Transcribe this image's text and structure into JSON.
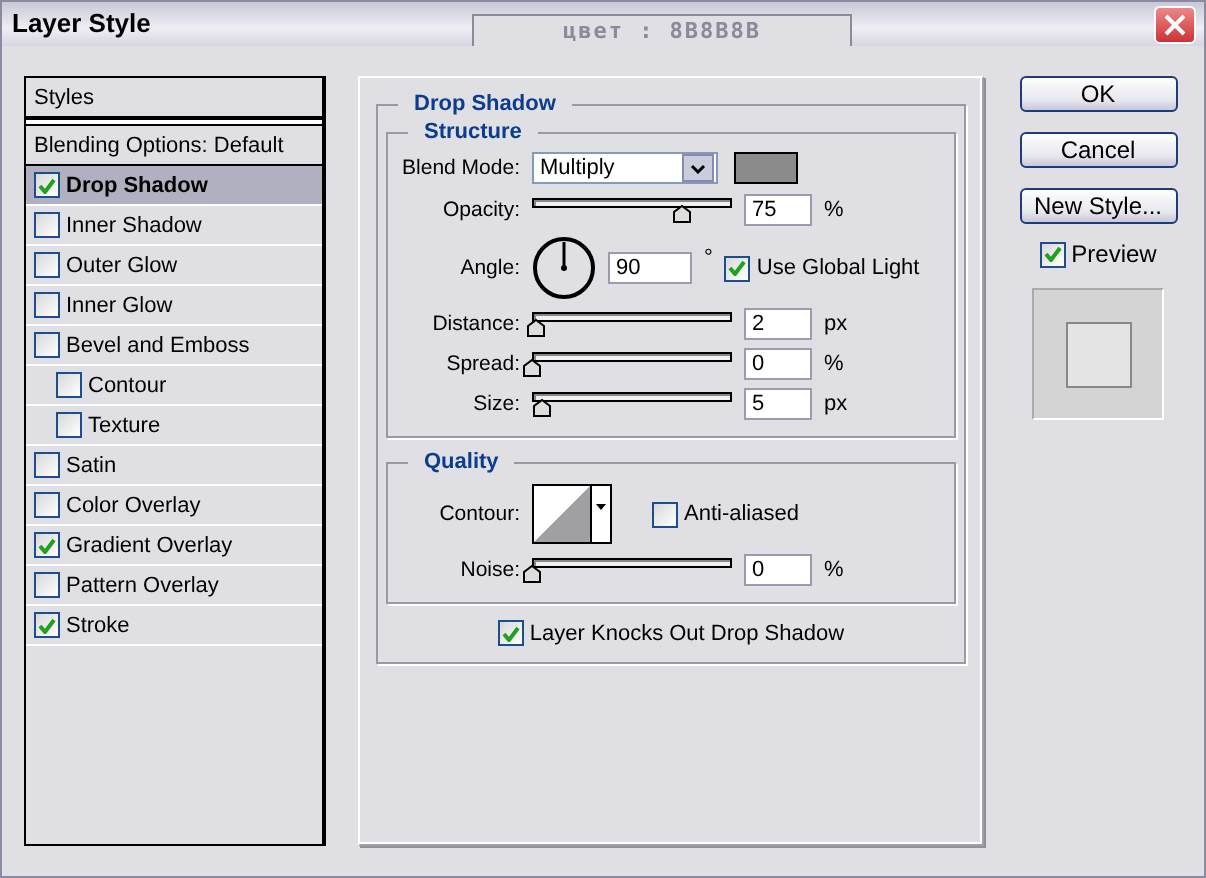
{
  "window": {
    "title": "Layer Style",
    "tab": "цвет : 8B8B8B"
  },
  "sidebar": {
    "items": [
      {
        "label": "Styles",
        "kind": "header"
      },
      {
        "label": "Blending Options: Default",
        "kind": "header"
      },
      {
        "label": "Drop Shadow",
        "kind": "effect",
        "checked": true,
        "selected": true
      },
      {
        "label": "Inner Shadow",
        "kind": "effect",
        "checked": false,
        "selected": false
      },
      {
        "label": "Outer Glow",
        "kind": "effect",
        "checked": false,
        "selected": false
      },
      {
        "label": "Inner Glow",
        "kind": "effect",
        "checked": false,
        "selected": false
      },
      {
        "label": "Bevel and Emboss",
        "kind": "effect",
        "checked": false,
        "selected": false,
        "children": [
          {
            "label": "Contour",
            "kind": "effect",
            "checked": false,
            "selected": false
          },
          {
            "label": "Texture",
            "kind": "effect",
            "checked": false,
            "selected": false
          }
        ]
      },
      {
        "label": "Satin",
        "kind": "effect",
        "checked": false,
        "selected": false
      },
      {
        "label": "Color Overlay",
        "kind": "effect",
        "checked": false,
        "selected": false
      },
      {
        "label": "Gradient Overlay",
        "kind": "effect",
        "checked": true,
        "selected": false
      },
      {
        "label": "Pattern Overlay",
        "kind": "effect",
        "checked": false,
        "selected": false
      },
      {
        "label": "Stroke",
        "kind": "effect",
        "checked": true,
        "selected": false
      }
    ]
  },
  "panel": {
    "title": "Drop Shadow",
    "structure": {
      "title": "Structure",
      "blend_mode": {
        "label": "Blend Mode:",
        "value": "Multiply",
        "color": "#8b8b8b"
      },
      "opacity": {
        "label": "Opacity:",
        "level": 0.75,
        "value": "75",
        "unit": "%"
      },
      "angle": {
        "label": "Angle:",
        "value": "90",
        "unit": "°",
        "global_light": {
          "label": "Use Global Light",
          "checked": true
        }
      },
      "sliders": [
        {
          "label": "Distance:",
          "level": 0.02,
          "value": "2",
          "unit": "px"
        },
        {
          "label": "Spread:",
          "level": 0,
          "value": "0",
          "unit": "%"
        },
        {
          "label": "Size:",
          "level": 0.05,
          "value": "5",
          "unit": "px"
        }
      ]
    },
    "quality": {
      "title": "Quality",
      "contour": {
        "label": "Contour:"
      },
      "anti_aliased": {
        "label": "Anti-aliased",
        "checked": false
      },
      "noise": {
        "label": "Noise:",
        "level": 0,
        "value": "0",
        "unit": "%"
      }
    },
    "knockout": {
      "label": "Layer Knocks Out Drop Shadow",
      "checked": true
    }
  },
  "buttons": [
    "OK",
    "Cancel",
    "New Style..."
  ],
  "preview": {
    "label": "Preview",
    "checked": true
  }
}
